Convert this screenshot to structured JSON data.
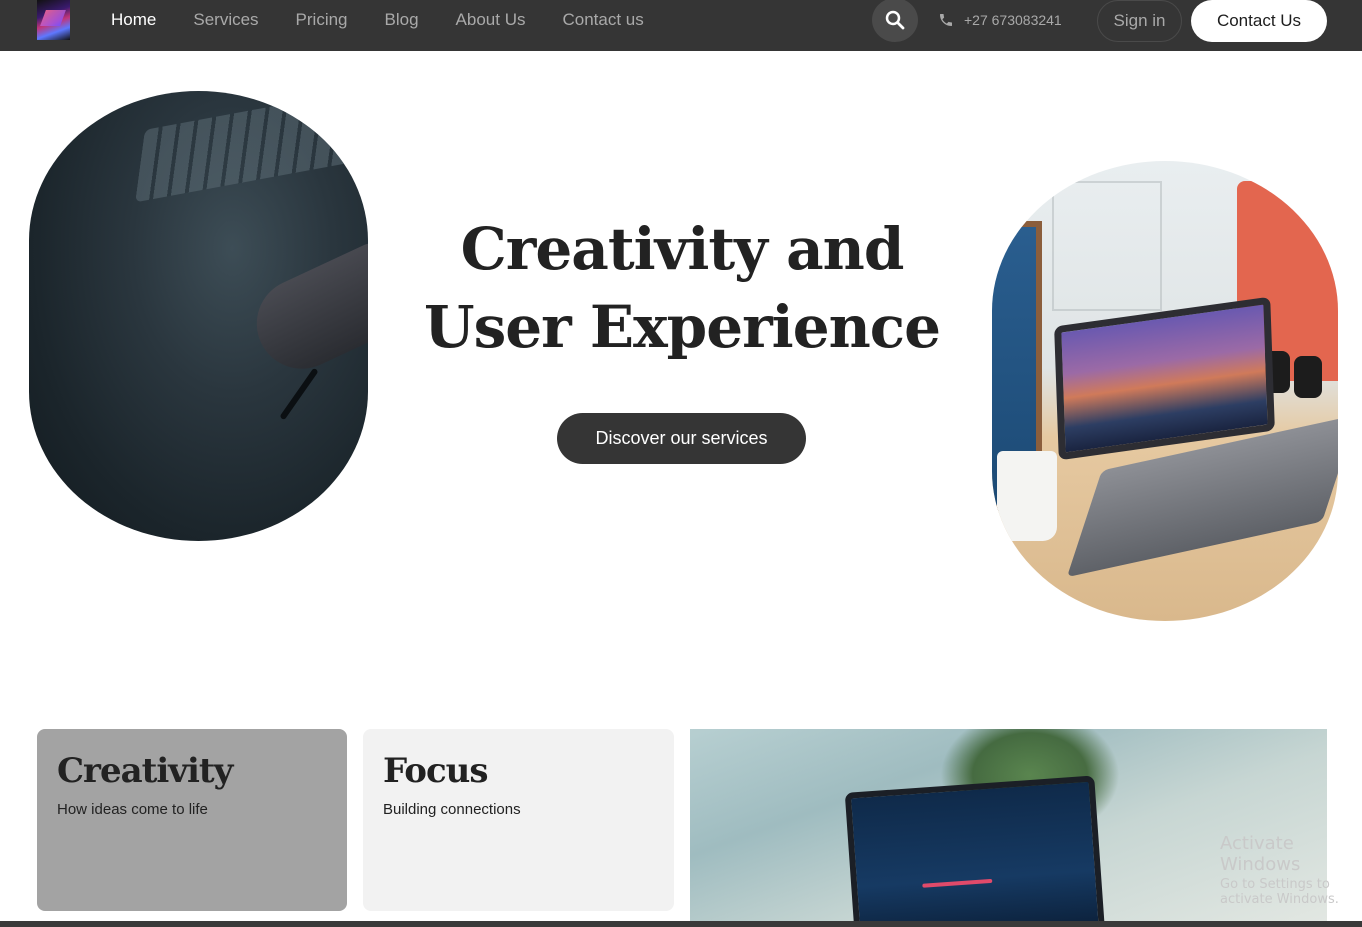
{
  "nav": {
    "links": [
      "Home",
      "Services",
      "Pricing",
      "Blog",
      "About Us",
      "Contact us"
    ],
    "active": "Home",
    "phone": "+27 673083241",
    "signin_label": "Sign in",
    "contact_label": "Contact Us"
  },
  "hero": {
    "title_line1": "Creativity and",
    "title_line2": "User Experience",
    "cta_label": "Discover our services"
  },
  "features": [
    {
      "title": "Creativity",
      "subtitle": "How ideas come to life"
    },
    {
      "title": "Focus",
      "subtitle": "Building connections"
    }
  ],
  "windows_watermark": {
    "title": "Activate Windows",
    "subtitle": "Go to Settings to activate Windows."
  },
  "colors": {
    "nav_bg": "#353535",
    "button_dark": "#353535",
    "card_creativity": "#a3a3a3",
    "card_focus": "#f2f2f2"
  },
  "icons": [
    "search-icon",
    "phone-icon"
  ]
}
